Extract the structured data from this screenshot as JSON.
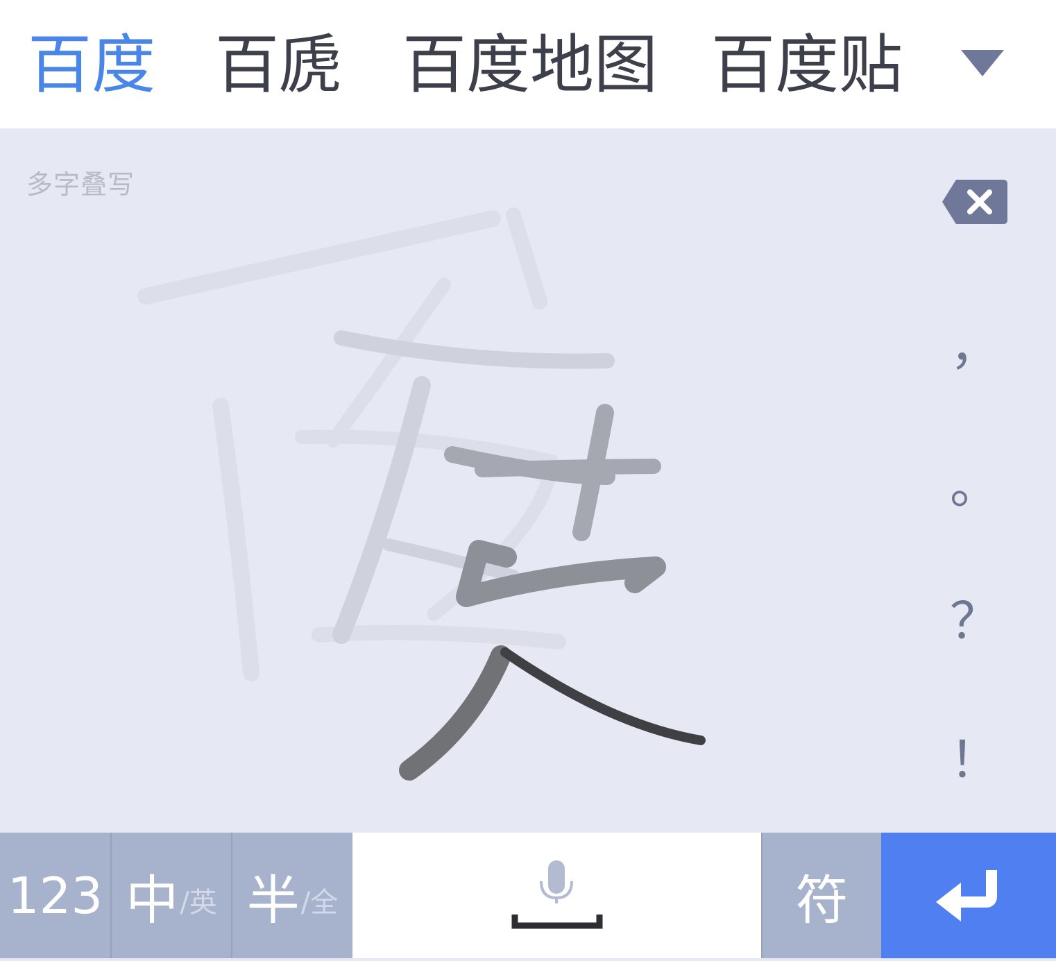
{
  "candidates": {
    "items": [
      "百度",
      "百虒",
      "百度地图",
      "百度贴吧"
    ],
    "active_index": 0
  },
  "pad": {
    "mode_label": "多字叠写",
    "punctuation": [
      "，",
      "。",
      "？",
      "！"
    ]
  },
  "toolbar": {
    "num_label": "123",
    "lang_primary": "中",
    "lang_secondary": "/英",
    "width_primary": "半",
    "width_secondary": "/全",
    "symbol_label": "符"
  },
  "colors": {
    "active_candidate": "#4a86e8",
    "enter_key": "#4f7ff0",
    "function_key": "#a7b2cc",
    "pad_background": "#e6e8f3"
  },
  "icons": {
    "more": "triangle-down-icon",
    "backspace": "backspace-icon",
    "voice": "microphone-icon",
    "space": "space-bar-icon",
    "enter": "enter-arrow-icon"
  }
}
